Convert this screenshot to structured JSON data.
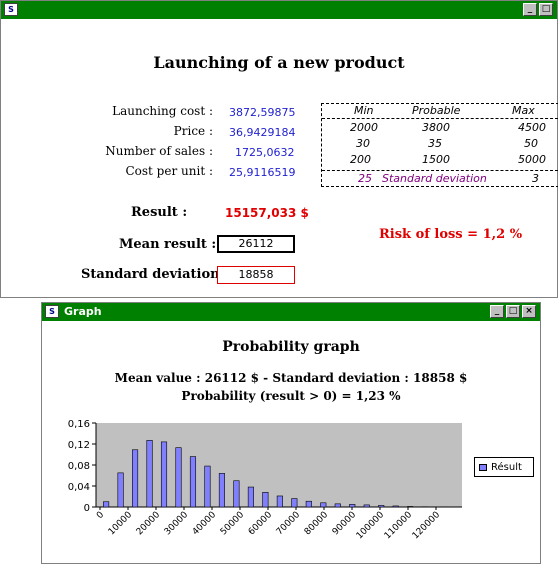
{
  "window_main": {
    "title": "",
    "heading": "Launching of a new product",
    "inputs": [
      {
        "label": "Launching cost :",
        "value": "3872,59875"
      },
      {
        "label": "Price :",
        "value": "36,9429184"
      },
      {
        "label": "Number of sales :",
        "value": "1725,0632"
      },
      {
        "label": "Cost per unit :",
        "value": "25,9116519"
      }
    ],
    "dist_table": {
      "headers": [
        "Min",
        "Probable",
        "Max"
      ],
      "rows": [
        [
          "2000",
          "3800",
          "4500"
        ],
        [
          "30",
          "35",
          "50"
        ],
        [
          "200",
          "1500",
          "5000"
        ]
      ],
      "footer": {
        "value": "25",
        "label": "Standard deviation",
        "value2": "3"
      }
    },
    "result_label": "Result :",
    "result_value": "15157,033 $",
    "mean_label": "Mean result :",
    "mean_value": "26112",
    "std_label": "Standard deviation :",
    "std_value": "18858",
    "risk": "Risk of loss = 1,2 %"
  },
  "window_graph": {
    "title": "Graph",
    "heading": "Probability graph",
    "subtitle1": "Mean value : 26112 $ - Standard deviation : 18858 $",
    "subtitle2": "Probability (result > 0) = 1,23 %"
  },
  "colors": {
    "titlebar": "#008000",
    "bar": "#8080ff",
    "plot_bg": "#c0c0c0",
    "result": "#e00000",
    "value": "#1f1fd0"
  },
  "chart_data": {
    "type": "bar",
    "title": "",
    "xlabel": "",
    "ylabel": "",
    "yticks": [
      "0",
      "0,04",
      "0,08",
      "0,12",
      "0,16"
    ],
    "ylim": [
      0,
      0.16
    ],
    "xticks": [
      "0",
      "10000",
      "20000",
      "30000",
      "40000",
      "50000",
      "60000",
      "70000",
      "80000",
      "90000",
      "100000",
      "110000",
      "120000"
    ],
    "series": [
      {
        "name": "Résult",
        "values": [
          0.01,
          0.065,
          0.109,
          0.127,
          0.124,
          0.113,
          0.096,
          0.078,
          0.064,
          0.05,
          0.038,
          0.028,
          0.021,
          0.016,
          0.011,
          0.008,
          0.006,
          0.005,
          0.004,
          0.003,
          0.002,
          0.001,
          0.0005,
          0.0003,
          0.0002
        ]
      }
    ],
    "grid": false,
    "legend": "right"
  }
}
